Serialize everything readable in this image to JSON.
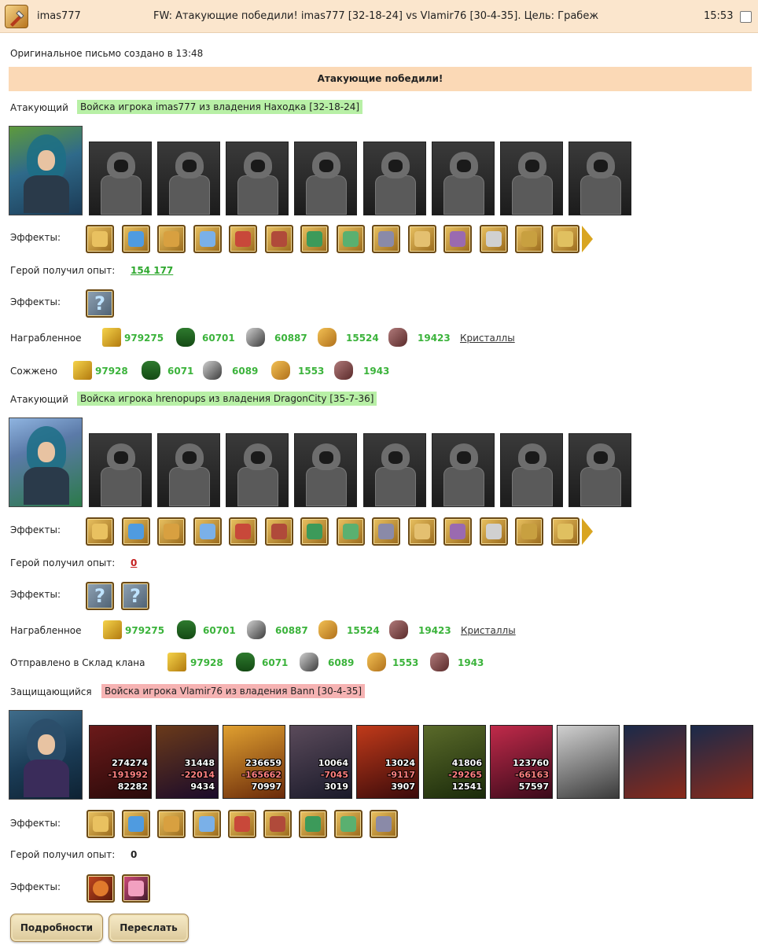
{
  "header": {
    "sender": "imas777",
    "subject": "FW: Атакующие победили! imas777 [32-18-24] vs Vlamir76 [30-4-35]. Цель: Грабеж",
    "time": "15:53"
  },
  "original_created": "Оригинальное письмо создано в 13:48",
  "banner": "Атакующие победили!",
  "attacker1": {
    "role": "Атакующий",
    "army": "Войска игрока imas777 из владения Находка [32-18-24]",
    "effects_label": "Эффекты:",
    "exp_label": "Герой получил опыт:",
    "exp_value": "154 177",
    "effects2_label": "Эффекты:",
    "looted_label": "Награбленное",
    "looted": [
      "979275",
      "60701",
      "60887",
      "15524",
      "19423"
    ],
    "crystals": "Кристаллы",
    "burned_label": "Сожжено",
    "burned": [
      "97928",
      "6071",
      "6089",
      "1553",
      "1943"
    ]
  },
  "attacker2": {
    "role": "Атакующий",
    "army": "Войска игрока hrenopups из владения DragonCity [35-7-36]",
    "effects_label": "Эффекты:",
    "exp_label": "Герой получил опыт:",
    "exp_value": "0",
    "effects2_label": "Эффекты:",
    "looted_label": "Награбленное",
    "looted": [
      "979275",
      "60701",
      "60887",
      "15524",
      "19423"
    ],
    "crystals": "Кристаллы",
    "sent_label": "Отправлено в Склад клана",
    "sent": [
      "97928",
      "6071",
      "6089",
      "1553",
      "1943"
    ]
  },
  "defender": {
    "role": "Защищающийся",
    "army": "Войска игрока Vlamir76 из владения Bann [30-4-35]",
    "units": [
      {
        "a": "274274",
        "b": "-191992",
        "c": "82282"
      },
      {
        "a": "31448",
        "b": "-22014",
        "c": "9434"
      },
      {
        "a": "236659",
        "b": "-165662",
        "c": "70997"
      },
      {
        "a": "10064",
        "b": "-7045",
        "c": "3019"
      },
      {
        "a": "13024",
        "b": "-9117",
        "c": "3907"
      },
      {
        "a": "41806",
        "b": "-29265",
        "c": "12541"
      },
      {
        "a": "123760",
        "b": "-66163",
        "c": "57597"
      }
    ],
    "effects_label": "Эффекты:",
    "exp_label": "Герой получил опыт:",
    "exp_value": "0",
    "effects2_label": "Эффекты:"
  },
  "buttons": {
    "details": "Подробности",
    "forward": "Переслать"
  },
  "colors": {
    "header_bg": "#fbe6cd",
    "banner_bg": "#fbd9b6",
    "attacker_tag": "#b8f0a6",
    "defender_tag": "#f6b3b3",
    "resource_value": "#3bb33b",
    "exp_link": "#2fa82f",
    "exp_zero": "#c42020"
  }
}
